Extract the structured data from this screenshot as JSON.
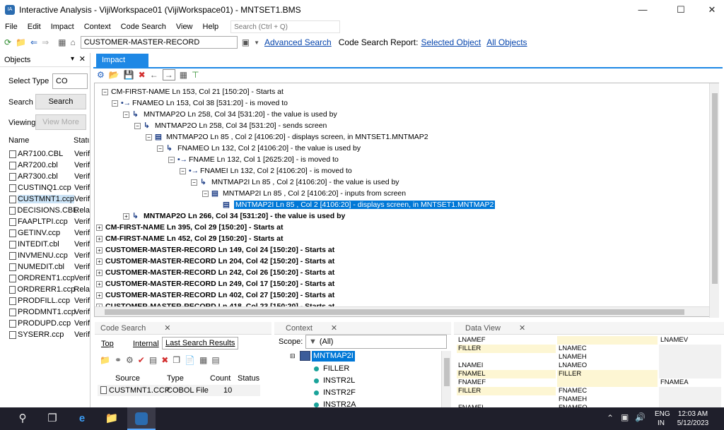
{
  "window": {
    "title": "Interactive Analysis - VijiWorkspace01 (VijiWorkspace01) - MNTSET1.BMS",
    "app_icon": "IA"
  },
  "menu": {
    "items": [
      "File",
      "Edit",
      "Impact",
      "Context",
      "Code Search",
      "View",
      "Help"
    ],
    "search_placeholder": "Search (Ctrl + Q)"
  },
  "toolbar": {
    "object_value": "CUSTOMER-MASTER-RECORD",
    "advanced_search": "Advanced Search",
    "report_label": "Code Search Report:",
    "selected_object": "Selected Object",
    "all_objects": "All Objects"
  },
  "objects": {
    "title": "Objects",
    "select_type_label": "Select Type",
    "type_value": "CO",
    "search_label": "Search",
    "search_button": "Search",
    "viewing_label": "Viewing",
    "view_more": "View More",
    "col_name": "Name",
    "col_status": "Statu",
    "items": [
      {
        "name": "AR7100.CBL",
        "status": "Verif"
      },
      {
        "name": "AR7200.cbl",
        "status": "Verif"
      },
      {
        "name": "AR7300.cbl",
        "status": "Verif"
      },
      {
        "name": "CUSTINQ1.ccp",
        "status": "Verif"
      },
      {
        "name": "CUSTMNT1.ccp",
        "status": "Verif"
      },
      {
        "name": "DECISIONS.CBL",
        "status": "Rela"
      },
      {
        "name": "FAAPLTPI.ccp",
        "status": "Verif"
      },
      {
        "name": "GETINV.ccp",
        "status": "Verif"
      },
      {
        "name": "INTEDIT.cbl",
        "status": "Verif"
      },
      {
        "name": "INVMENU.ccp",
        "status": "Verif"
      },
      {
        "name": "NUMEDIT.cbl",
        "status": "Verif"
      },
      {
        "name": "ORDRENT1.ccp",
        "status": "Verif"
      },
      {
        "name": "ORDRERR1.ccp",
        "status": "Rela"
      },
      {
        "name": "PRODFILL.ccp",
        "status": "Verif"
      },
      {
        "name": "PRODMNT1.ccp",
        "status": "Verif"
      },
      {
        "name": "PRODUPD.ccp",
        "status": "Verif"
      },
      {
        "name": "SYSERR.ccp",
        "status": "Verif"
      }
    ]
  },
  "impact": {
    "tab": "Impact",
    "tree": [
      {
        "text": "CM-FIRST-NAME Ln 153, Col 21 [150:20] - Starts at",
        "bold": false
      },
      {
        "text": "FNAMEO Ln 153, Col 38 [531:20] - is moved to",
        "bold": false
      },
      {
        "text": "MNTMAP2O Ln 258, Col 34 [531:20] - the value is used by",
        "bold": false
      },
      {
        "text": "MNTMAP2O Ln 258, Col 34 [531:20] - sends screen",
        "bold": false
      },
      {
        "text": "MNTMAP2O Ln 85 , Col 2 [4106:20] - displays screen, in MNTSET1.MNTMAP2",
        "bold": false
      },
      {
        "text": "FNAMEO Ln 132, Col 2 [4106:20] - the value is used by",
        "bold": false
      },
      {
        "text": "FNAME Ln 132, Col 1 [2625:20] - is moved to",
        "bold": false
      },
      {
        "text": "FNAMEI Ln 132, Col 2 [4106:20] - is moved to",
        "bold": false
      },
      {
        "text": "MNTMAP2I Ln 85 , Col 2 [4106:20] - the value is used by",
        "bold": false
      },
      {
        "text": "MNTMAP2I Ln 85 , Col 2 [4106:20] - inputs from screen",
        "bold": false
      },
      {
        "text": "MNTMAP2I Ln 85 , Col 2 [4106:20] - displays screen, in MNTSET1.MNTMAP2",
        "bold": false
      },
      {
        "text": "MNTMAP2O Ln 266, Col 34 [531:20] - the value is used by",
        "bold": true
      },
      {
        "text": "CM-FIRST-NAME Ln 395, Col 29 [150:20] - Starts at",
        "bold": true
      },
      {
        "text": "CM-FIRST-NAME Ln 452, Col 29 [150:20] - Starts at",
        "bold": true
      },
      {
        "text": "CUSTOMER-MASTER-RECORD Ln 149, Col 24 [150:20] - Starts at",
        "bold": true
      },
      {
        "text": "CUSTOMER-MASTER-RECORD Ln 204, Col 42 [150:20] - Starts at",
        "bold": true
      },
      {
        "text": "CUSTOMER-MASTER-RECORD Ln 242, Col 26 [150:20] - Starts at",
        "bold": true
      },
      {
        "text": "CUSTOMER-MASTER-RECORD Ln 249, Col 17 [150:20] - Starts at",
        "bold": true
      },
      {
        "text": "CUSTOMER-MASTER-RECORD Ln 402, Col 27 [150:20] - Starts at",
        "bold": true
      },
      {
        "text": "CUSTOMER-MASTER-RECORD Ln 418, Col 23 [150:20] - Starts at",
        "bold": true
      }
    ]
  },
  "code_search": {
    "title": "Code Search",
    "tabs": [
      "Top",
      "Internal",
      "Last Search Results"
    ],
    "columns": [
      "Source",
      "Type",
      "Count",
      "Status"
    ],
    "row": {
      "source": "CUSTMNT1.CCP",
      "type": "COBOL File",
      "count": "10",
      "status": ""
    }
  },
  "context": {
    "title": "Context",
    "scope_label": "Scope:",
    "scope_value": "(All)",
    "root": "MNTMAP2I",
    "items": [
      "FILLER",
      "INSTR2L",
      "INSTR2F",
      "INSTR2A",
      "FILLER"
    ]
  },
  "data_view": {
    "title": "Data View",
    "rows": [
      [
        "LNAMEF",
        "",
        "LNAMEV"
      ],
      [
        "FILLER",
        "LNAMEC",
        ""
      ],
      [
        "",
        "LNAMEH",
        ""
      ],
      [
        "LNAMEI",
        "LNAMEO",
        ""
      ],
      [
        "FNAMEL",
        "FILLER",
        ""
      ],
      [
        "FNAMEF",
        "",
        "FNAMEA"
      ],
      [
        "FILLER",
        "FNAMEC",
        ""
      ],
      [
        "",
        "FNAMEH",
        ""
      ],
      [
        "FNAMEI",
        "FNAMEO",
        ""
      ],
      [
        "ADDRL",
        "FILLER",
        ""
      ]
    ]
  },
  "taskbar": {
    "lang": "ENG",
    "region": "IN",
    "time": "12:03 AM",
    "date": "5/12/2023"
  }
}
